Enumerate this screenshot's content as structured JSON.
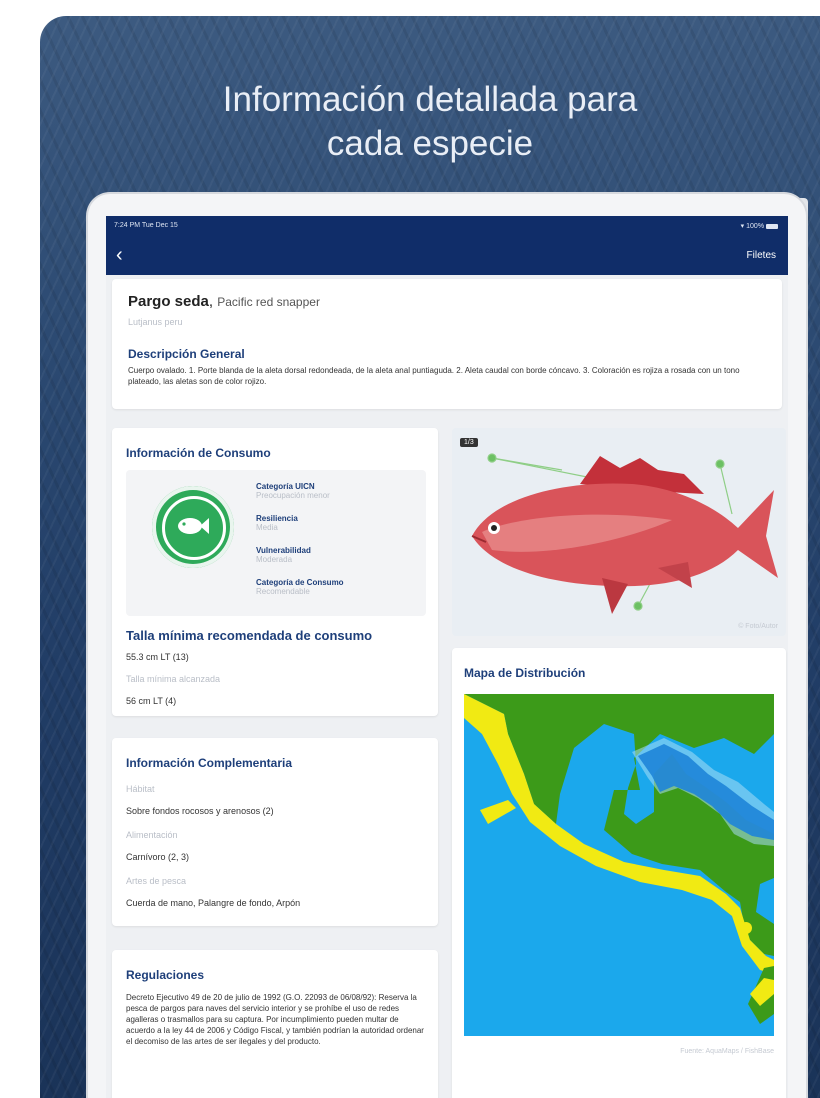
{
  "promo": {
    "headline_line1": "Información detallada para",
    "headline_line2": "cada especie"
  },
  "statusbar": {
    "time": "7:24 PM  Tue Dec 15",
    "battery": "100%"
  },
  "nav": {
    "back_icon": "chevron-left-icon",
    "right_label": "Filetes"
  },
  "species": {
    "common_name": "Pargo seda",
    "english_name": "Pacific red snapper",
    "scientific_name": "Lutjanus peru",
    "general_title": "Descripción General",
    "general_text": "Cuerpo ovalado. 1. Porte blanda de la aleta dorsal redondeada, de la aleta anal puntiaguda. 2. Aleta caudal con borde cóncavo. 3. Coloración es rojiza a rosada con un tono plateado, las aletas son de color rojizo."
  },
  "consumo": {
    "title": "Información de Consumo",
    "logo_icon": "fish-icon",
    "logo_color": "#2eaa5a",
    "items": [
      {
        "label": "Categoría UICN",
        "value": "Preocupación menor"
      },
      {
        "label": "Resiliencia",
        "value": "Media"
      },
      {
        "label": "Vulnerabilidad",
        "value": "Moderada"
      },
      {
        "label": "Categoría de Consumo",
        "value": "Recomendable"
      }
    ],
    "talla_title": "Talla mínima recomendada de consumo",
    "talla_value": "55.3 cm LT (13)",
    "talla_alcanzada_label": "Talla mínima alcanzada",
    "talla_alcanzada_value": "56 cm LT (4)"
  },
  "complementaria": {
    "title": "Información Complementaria",
    "rows": [
      {
        "label": "Hábitat",
        "value": "Sobre fondos rocosos y arenosos (2)"
      },
      {
        "label": "Alimentación",
        "value": "Carnívoro (2, 3)"
      },
      {
        "label": "Artes de pesca",
        "value": "Cuerda de mano, Palangre de fondo, Arpón"
      }
    ]
  },
  "regulaciones": {
    "title": "Regulaciones",
    "text": "Decreto Ejecutivo 49 de 20 de julio de 1992 (G.O. 22093 de 06/08/92): Reserva la pesca de pargos para naves del servicio interior y se prohíbe el uso de redes agalleras o trasmallos para su captura. Por incumplimiento pueden multar de acuerdo a la ley 44 de 2006 y Código Fiscal, y también podrían la autoridad ordenar el decomiso de las artes de ser ilegales y del producto."
  },
  "photo": {
    "badge": "1/3",
    "credit": "© Foto/Autor"
  },
  "mapa": {
    "title": "Mapa de Distribución",
    "credit": "Fuente: AquaMaps / FishBase",
    "colors": {
      "ocean": "#1ba8ec",
      "land": "#3c9a19",
      "range": "#f1ea13",
      "shelf": "#a9dcf5"
    }
  }
}
